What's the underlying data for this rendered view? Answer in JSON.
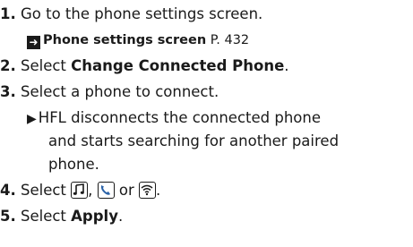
{
  "steps": [
    {
      "num": "1.",
      "text": "Go to the phone settings screen."
    },
    {
      "num": "2.",
      "pre": "Select ",
      "bold": "Change Connected Phone",
      "post": "."
    },
    {
      "num": "3.",
      "text": "Select a phone to connect."
    },
    {
      "num": "4.",
      "pre": "Select ",
      "sep1": ", ",
      "sep2": " or ",
      "post": "."
    },
    {
      "num": "5.",
      "pre": "Select ",
      "bold": "Apply",
      "post": "."
    }
  ],
  "reference": {
    "title": "Phone settings screen",
    "page": " P. 432"
  },
  "note": {
    "line1": "HFL disconnects the connected phone",
    "line2": "and starts searching for another paired",
    "line3": "phone."
  },
  "icons": [
    "music-note-icon",
    "phone-handset-icon",
    "wifi-icon"
  ]
}
